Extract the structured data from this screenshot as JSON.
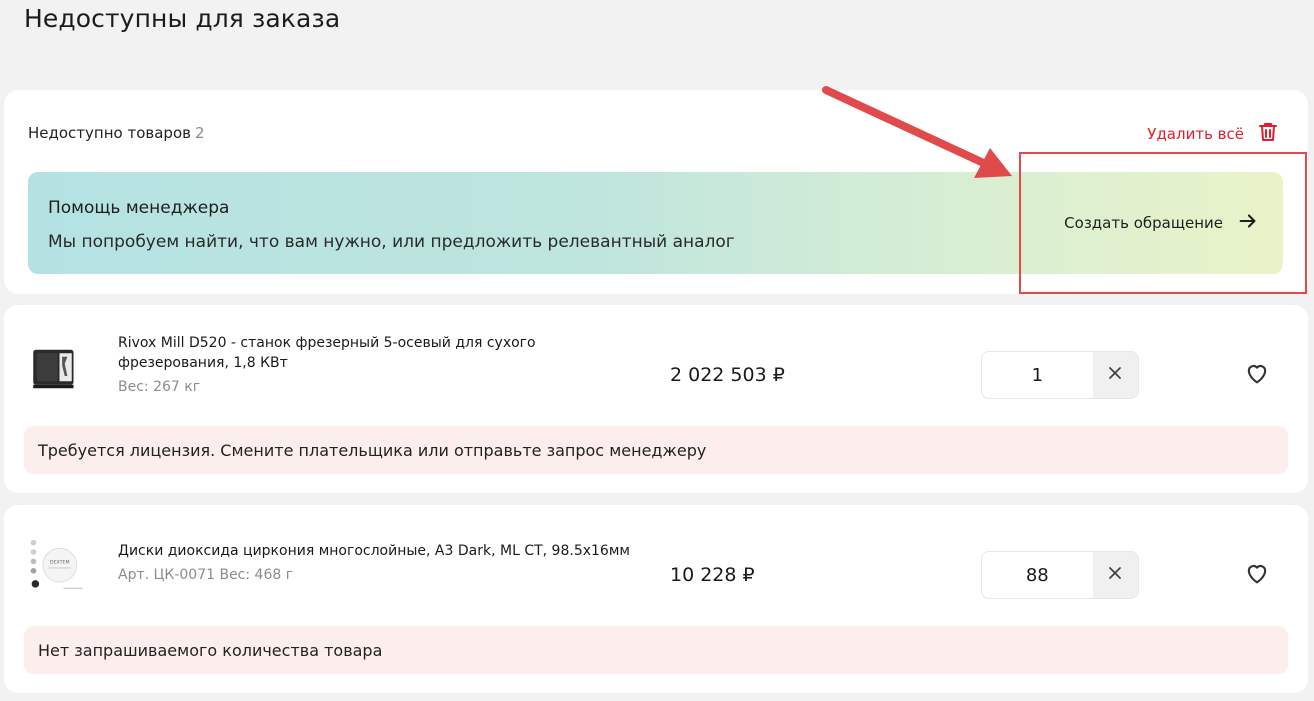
{
  "page": {
    "title": "Недоступны для заказа"
  },
  "summary": {
    "label": "Недоступно товаров",
    "count": "2",
    "delete_all": "Удалить всё",
    "icon_delete": "trash-icon",
    "accent_color": "#e01f2a"
  },
  "manager_help": {
    "title": "Помощь менеджера",
    "subtitle": "Мы попробуем найти, что вам нужно, или предложить релевантный аналог",
    "action": "Создать обращение",
    "icon_action": "arrow-right-icon"
  },
  "products": [
    {
      "name": "Rivox Mill D520 - станок фрезерный 5-осевый для сухого фрезерования, 1,8 КВт",
      "meta": "Вес: 267 кг",
      "price": "2 022 503 ₽",
      "quantity": "1",
      "warning": "Требуется лицензия. Смените плательщика или отправьте запрос менеджеру"
    },
    {
      "name": "Диски диоксида циркония многослойные, A3 Dark, ML CT, 98.5x16мм",
      "meta": "Арт. ЦК-0071 Вес: 468 г",
      "price": "10 228 ₽",
      "quantity": "88",
      "warning": "Нет запрашиваемого количества товара"
    }
  ],
  "colors": {
    "background": "#f2f2f3",
    "warning_bg": "#fdeeee",
    "annotation": "#e04a4a"
  }
}
